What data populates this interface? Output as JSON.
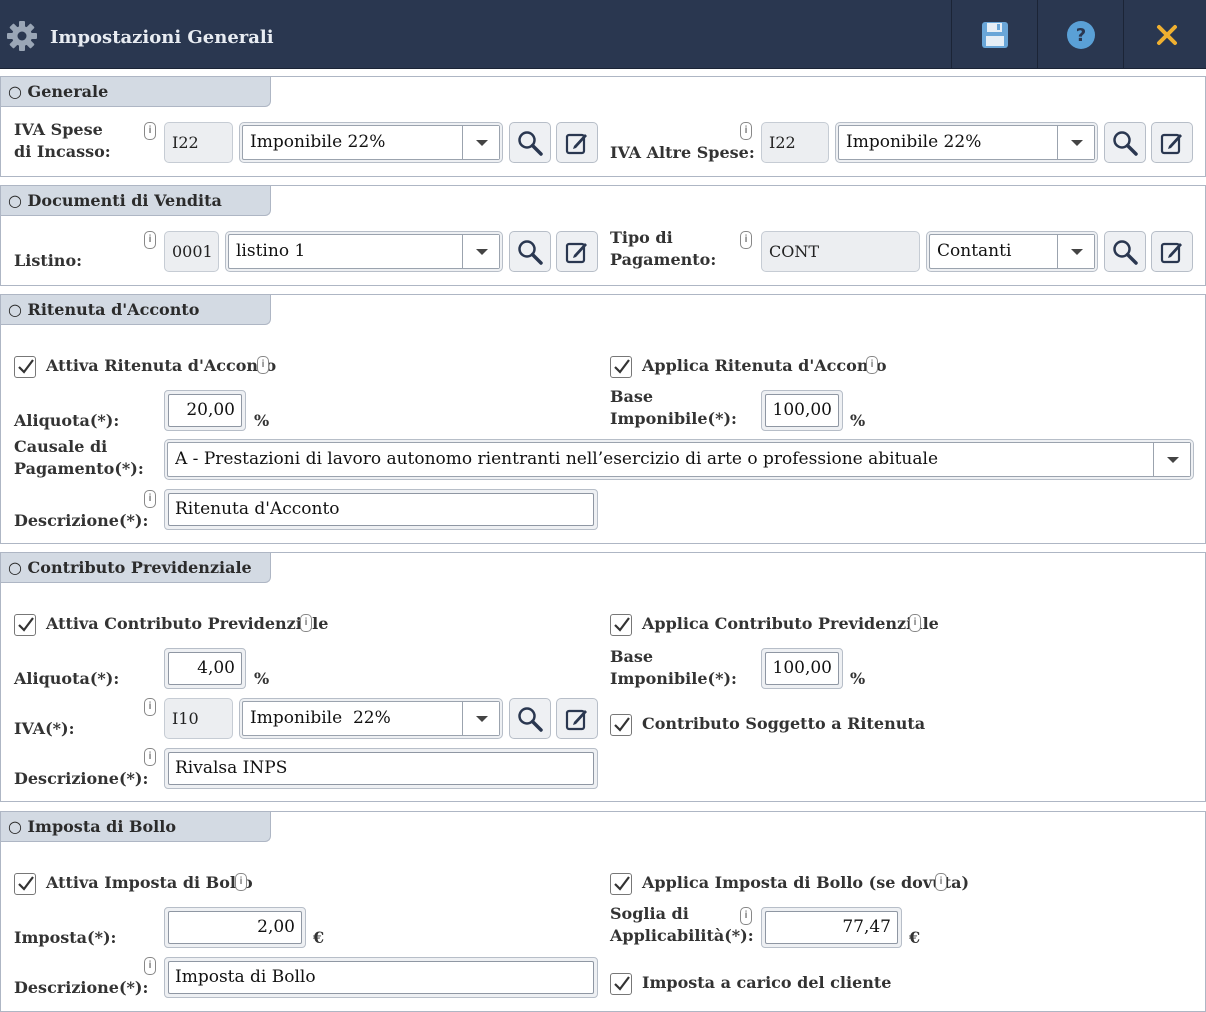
{
  "window": {
    "title": "Impostazioni Generali",
    "buttons": {
      "save": "save-icon",
      "help": "help-icon",
      "close": "close-icon"
    }
  },
  "generale": {
    "tab": "Generale",
    "iva_spese_incasso": {
      "label": "IVA Spese di Incasso:",
      "code": "I22",
      "value": "Imponibile 22%"
    },
    "iva_altre_spese": {
      "label": "IVA Altre Spese:",
      "code": "I22",
      "value": "Imponibile 22%"
    }
  },
  "vendita": {
    "tab": "Documenti di Vendita",
    "listino": {
      "label": "Listino:",
      "code": "0001",
      "value": "listino 1"
    },
    "pagamento": {
      "label": "Tipo di Pagamento:",
      "code": "CONT",
      "value": "Contanti"
    }
  },
  "ritenuta": {
    "tab": "Ritenuta d'Acconto",
    "attiva": {
      "label": "Attiva Ritenuta d'Acconto",
      "checked": true
    },
    "applica": {
      "label": "Applica Ritenuta d'Acconto",
      "checked": true
    },
    "aliquota_label": "Aliquota(*):",
    "aliquota": "20,00",
    "base_label": "Base Imponibile(*):",
    "base": "100,00",
    "unit": "%",
    "causale_label": "Causale di Pagamento(*):",
    "causale": "A - Prestazioni di lavoro autonomo rientranti nell’esercizio di arte o professione abituale",
    "descr_label": "Descrizione(*):",
    "descrizione": "Ritenuta d'Acconto"
  },
  "contributo": {
    "tab": "Contributo Previdenziale",
    "attiva": {
      "label": "Attiva Contributo Previdenziale",
      "checked": true
    },
    "applica": {
      "label": "Applica Contributo Previdenziale",
      "checked": true
    },
    "aliquota_label": "Aliquota(*):",
    "aliquota": "4,00",
    "base_label": "Base Imponibile(*):",
    "base": "100,00",
    "unit": "%",
    "iva_label": "IVA(*):",
    "iva_code": "I10",
    "iva_value": "Imponibile  22%",
    "soggetto": {
      "label": "Contributo Soggetto a Ritenuta",
      "checked": true
    },
    "descr_label": "Descrizione(*):",
    "descrizione": "Rivalsa INPS"
  },
  "bollo": {
    "tab": "Imposta di Bollo",
    "attiva": {
      "label": "Attiva Imposta di Bollo",
      "checked": true
    },
    "applica": {
      "label": "Applica Imposta di Bollo (se dovuta)",
      "checked": true
    },
    "imposta_label": "Imposta(*):",
    "imposta": "2,00",
    "soglia_label": "Soglia di Applicabilità(*):",
    "soglia": "77,47",
    "unit": "€",
    "carico": {
      "label": "Imposta a carico del cliente",
      "checked": true
    },
    "descr_label": "Descrizione(*):",
    "descrizione": "Imposta di Bollo"
  },
  "info_glyph": "i"
}
